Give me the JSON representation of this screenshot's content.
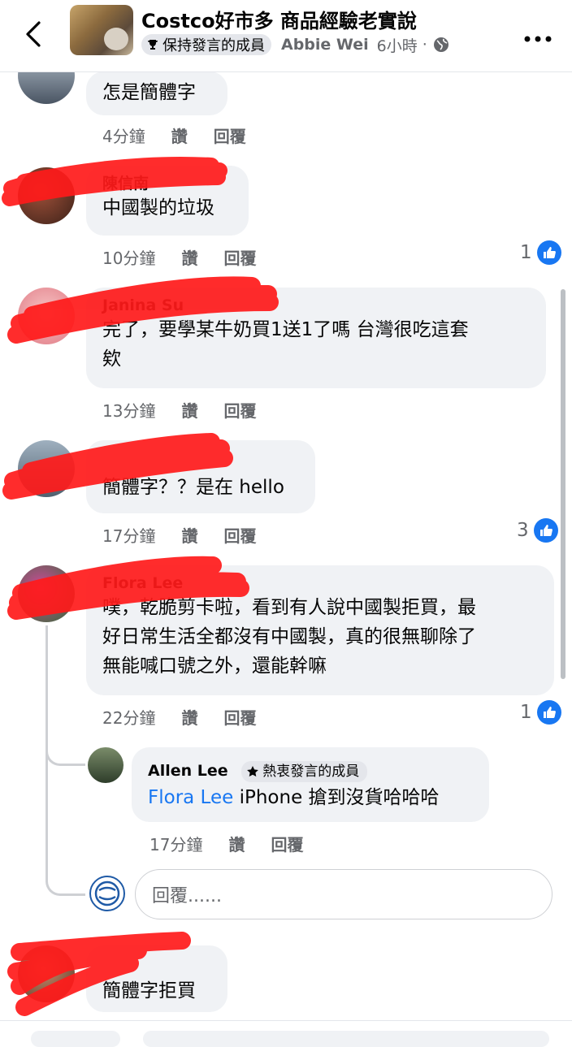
{
  "header": {
    "group_name": "Costco好市多 商品經驗老實說",
    "member_badge": "保持發言的成員",
    "author": "Abbie Wei",
    "time": "6小時",
    "separator": "·"
  },
  "comments": [
    {
      "name": "",
      "text": "怎是簡體字",
      "time": "4分鐘",
      "like": "讚",
      "reply": "回覆"
    },
    {
      "name": "陳信南",
      "text": "中國製的垃圾",
      "time": "10分鐘",
      "like": "讚",
      "reply": "回覆",
      "reactions": "1"
    },
    {
      "name": "Janina Su",
      "text": "完了，要學某牛奶買1送1了嗎 台灣很吃這套\n欸",
      "time": "13分鐘",
      "like": "讚",
      "reply": "回覆"
    },
    {
      "name": "",
      "text": "簡體字？？是在 hello",
      "time": "17分鐘",
      "like": "讚",
      "reply": "回覆",
      "reactions": "3"
    },
    {
      "name": "Flora Lee",
      "text": "噗，乾脆剪卡啦，看到有人說中國製拒買，最\n好日常生活全都沒有中國製，真的很無聊除了\n無能喊口號之外，還能幹嘛",
      "time": "22分鐘",
      "like": "讚",
      "reply": "回覆",
      "reactions": "1"
    },
    {
      "name": "",
      "text": "簡體字拒買"
    }
  ],
  "reply": {
    "name": "Allen Lee",
    "badge": "熱衷發言的成員",
    "mention": "Flora Lee",
    "text": " iPhone 搶到沒貨哈哈哈",
    "time": "17分鐘",
    "like": "讚",
    "reply": "回覆"
  },
  "reply_input": {
    "placeholder": "回覆......"
  },
  "colors": {
    "accent": "#1877f2",
    "bubble": "#f0f2f5",
    "scribble": "#ff1a1a",
    "meta": "#65676b"
  },
  "icons": [
    "chevron-left-icon",
    "trophy-icon",
    "globe-icon",
    "more-icon",
    "thumbs-up-icon",
    "star-icon"
  ]
}
